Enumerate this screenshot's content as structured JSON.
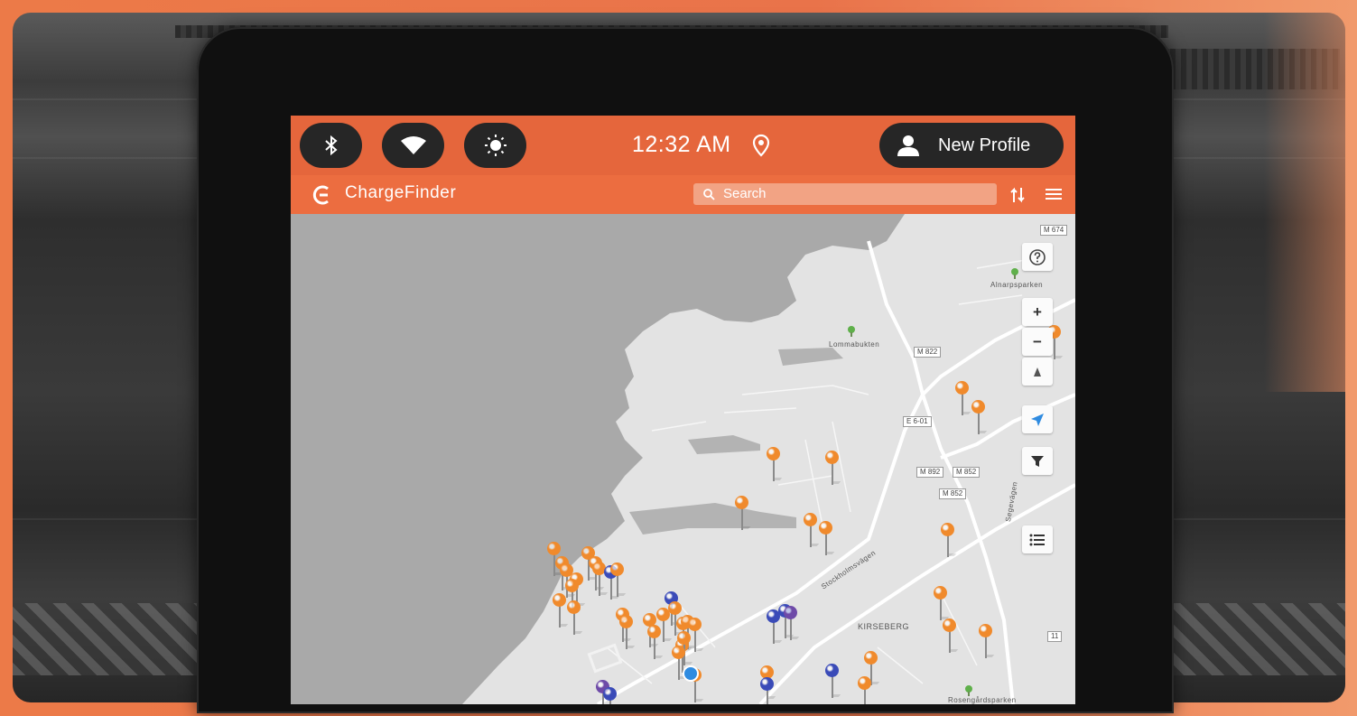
{
  "status_bar": {
    "time": "12:32 AM",
    "profile_label": "New Profile",
    "icons": [
      "bluetooth-icon",
      "wifi-icon",
      "brightness-icon",
      "location-icon",
      "user-icon"
    ]
  },
  "app_bar": {
    "brand": "ChargeFinder",
    "search_placeholder": "Search",
    "icons": [
      "chargefinder-logo-icon",
      "search-icon",
      "sort-icon",
      "menu-icon"
    ]
  },
  "map": {
    "controls": [
      "help-icon",
      "zoom-in-icon",
      "zoom-out-icon",
      "compass-icon",
      "navigate-icon",
      "filter-icon",
      "list-icon"
    ],
    "road_labels": [
      "M 822",
      "M 674",
      "M 892",
      "E 6-01",
      "M 852",
      "M 852",
      "11"
    ],
    "place_labels": [
      "Alnarpsparken",
      "Lommabukten",
      "Stockholmsvägen",
      "KIRSEBERG",
      "Segevägen",
      "Rosengårdsparken"
    ]
  },
  "colors": {
    "accent": "#e5663c",
    "app_bar": "#ec6d40",
    "pill": "#262626",
    "pin_orange": "#f08a2c",
    "pin_blue": "#3a4bb8",
    "pin_purple": "#6e4aa8",
    "map_water": "#a9a9a9",
    "map_land": "#e3e3e3"
  }
}
